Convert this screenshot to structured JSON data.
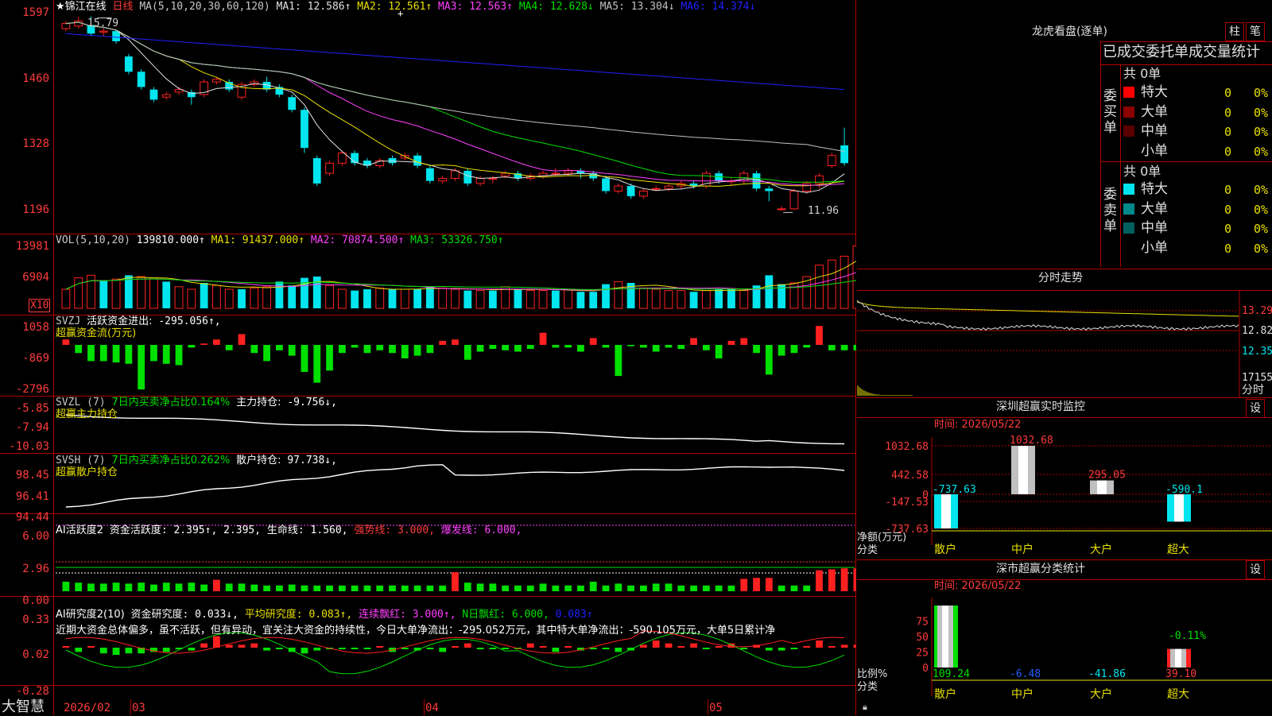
{
  "colors": {
    "up": "#ff2020",
    "down": "#00e5ee",
    "border": "#b00000",
    "ma1": "#e0e0e0",
    "ma2": "#e8e000",
    "ma3": "#ff40ff",
    "ma4": "#00e000",
    "ma5": "#c0c0c0",
    "ma6": "#2020ff"
  },
  "main_chart": {
    "stock_name": "★锦江在线",
    "period": "日线",
    "indicator": "MA(5,10,20,30,60,120)",
    "ma_items": [
      {
        "label": "MA1:",
        "value": "12.586↑"
      },
      {
        "label": "MA2:",
        "value": "12.561↑"
      },
      {
        "label": "MA3:",
        "value": "12.563↑"
      },
      {
        "label": "MA4:",
        "value": "12.628↓"
      },
      {
        "label": "MA5:",
        "value": "13.304↓"
      },
      {
        "label": "MA6:",
        "value": "14.374↓"
      }
    ],
    "y_ticks": [
      "1597",
      "1460",
      "1328",
      "1196"
    ],
    "high_label": "15.79",
    "low_label": "11.96",
    "price_range": [
      11.7,
      16.05
    ],
    "candles": [
      [
        15.55,
        15.65,
        15.5,
        15.7
      ],
      [
        15.6,
        15.7,
        15.55,
        15.78
      ],
      [
        15.62,
        15.45,
        15.4,
        15.79
      ],
      [
        15.48,
        15.5,
        15.4,
        15.56
      ],
      [
        15.5,
        15.3,
        15.25,
        15.52
      ],
      [
        15.0,
        14.7,
        14.65,
        15.05
      ],
      [
        14.7,
        14.4,
        14.35,
        14.75
      ],
      [
        14.35,
        14.15,
        14.1,
        14.4
      ],
      [
        14.2,
        14.25,
        14.15,
        14.3
      ],
      [
        14.3,
        14.35,
        14.25,
        14.4
      ],
      [
        14.3,
        14.2,
        14.05,
        14.35
      ],
      [
        14.25,
        14.5,
        14.2,
        14.55
      ],
      [
        14.5,
        14.55,
        14.45,
        14.6
      ],
      [
        14.5,
        14.35,
        14.3,
        14.55
      ],
      [
        14.2,
        14.45,
        14.15,
        14.5
      ],
      [
        14.45,
        14.5,
        14.4,
        14.55
      ],
      [
        14.5,
        14.35,
        14.3,
        14.6
      ],
      [
        14.4,
        14.25,
        14.2,
        14.45
      ],
      [
        14.2,
        13.95,
        13.9,
        14.25
      ],
      [
        13.95,
        13.2,
        13.1,
        14.0
      ],
      [
        13.0,
        12.5,
        12.45,
        13.05
      ],
      [
        12.7,
        12.9,
        12.65,
        12.95
      ],
      [
        12.9,
        13.1,
        12.85,
        13.15
      ],
      [
        13.1,
        12.9,
        12.85,
        13.15
      ],
      [
        12.95,
        12.85,
        12.8,
        13.0
      ],
      [
        12.85,
        12.95,
        12.8,
        13.0
      ],
      [
        13.0,
        12.9,
        12.85,
        13.05
      ],
      [
        13.0,
        13.05,
        12.95,
        13.1
      ],
      [
        13.05,
        12.85,
        12.8,
        13.1
      ],
      [
        12.8,
        12.55,
        12.5,
        12.85
      ],
      [
        12.55,
        12.6,
        12.5,
        12.65
      ],
      [
        12.6,
        12.75,
        12.55,
        12.8
      ],
      [
        12.75,
        12.5,
        12.45,
        12.8
      ],
      [
        12.5,
        12.6,
        12.45,
        12.65
      ],
      [
        12.6,
        12.6,
        12.5,
        12.65
      ],
      [
        12.65,
        12.7,
        12.6,
        12.75
      ],
      [
        12.7,
        12.6,
        12.55,
        12.75
      ],
      [
        12.6,
        12.65,
        12.55,
        12.7
      ],
      [
        12.65,
        12.7,
        12.6,
        12.75
      ],
      [
        12.7,
        12.7,
        12.65,
        12.8
      ],
      [
        12.7,
        12.75,
        12.65,
        12.8
      ],
      [
        12.75,
        12.7,
        12.6,
        12.8
      ],
      [
        12.7,
        12.6,
        12.55,
        12.75
      ],
      [
        12.6,
        12.35,
        12.3,
        12.65
      ],
      [
        12.35,
        12.45,
        12.3,
        12.5
      ],
      [
        12.45,
        12.25,
        12.2,
        12.5
      ],
      [
        12.25,
        12.35,
        12.2,
        12.4
      ],
      [
        12.4,
        12.4,
        12.35,
        12.45
      ],
      [
        12.4,
        12.45,
        12.35,
        12.5
      ],
      [
        12.45,
        12.5,
        12.4,
        12.55
      ],
      [
        12.5,
        12.45,
        12.4,
        12.55
      ],
      [
        12.45,
        12.7,
        12.4,
        12.75
      ],
      [
        12.7,
        12.55,
        12.5,
        12.75
      ],
      [
        12.55,
        12.55,
        12.45,
        12.6
      ],
      [
        12.55,
        12.7,
        12.5,
        12.75
      ],
      [
        12.7,
        12.4,
        12.35,
        12.75
      ],
      [
        12.4,
        12.35,
        12.15,
        12.45
      ],
      [
        12.0,
        12.0,
        11.96,
        12.05
      ],
      [
        12.0,
        12.35,
        11.98,
        12.4
      ],
      [
        12.35,
        12.5,
        12.3,
        12.55
      ],
      [
        12.5,
        12.65,
        12.4,
        12.7
      ],
      [
        12.85,
        13.05,
        12.8,
        13.1
      ],
      [
        13.25,
        12.9,
        12.85,
        13.6
      ]
    ]
  },
  "vol_panel": {
    "label": "VOL(5,10,20)",
    "value": "139810.000↑",
    "ma_items": [
      {
        "label": "MA1:",
        "value": "91437.000↑"
      },
      {
        "label": "MA2:",
        "value": "70874.500↑"
      },
      {
        "label": "MA3:",
        "value": "53326.750↑"
      }
    ],
    "y_ticks": [
      "13981",
      "6904"
    ],
    "unit_badge": "X10",
    "values": [
      30,
      48,
      52,
      44,
      46,
      52,
      50,
      48,
      42,
      34,
      30,
      40,
      36,
      30,
      30,
      32,
      34,
      42,
      36,
      48,
      50,
      36,
      30,
      28,
      30,
      32,
      30,
      30,
      30,
      34,
      32,
      30,
      28,
      28,
      28,
      34,
      30,
      28,
      28,
      28,
      30,
      26,
      26,
      38,
      42,
      40,
      32,
      30,
      28,
      28,
      26,
      28,
      30,
      30,
      28,
      36,
      52,
      38,
      40,
      50,
      68,
      76,
      82,
      98
    ],
    "ups": [
      1,
      1,
      1,
      0,
      1,
      0,
      1,
      1,
      0,
      1,
      1,
      0,
      1,
      1,
      0,
      1,
      1,
      0,
      0,
      0,
      0,
      1,
      1,
      0,
      0,
      1,
      0,
      1,
      0,
      0,
      1,
      1,
      0,
      1,
      0,
      1,
      0,
      1,
      1,
      0,
      1,
      0,
      0,
      0,
      1,
      0,
      1,
      1,
      1,
      1,
      0,
      1,
      0,
      0,
      1,
      0,
      0,
      0,
      1,
      1,
      1,
      1,
      1,
      1
    ]
  },
  "svzj_panel": {
    "label": "SVZJ",
    "desc": "活跃资金进出:",
    "value": "-295.056↑,",
    "subtitle": "超赢资金流(万元)",
    "y_ticks": [
      "1058",
      "-869",
      "-2796"
    ],
    "values": [
      40,
      -60,
      -120,
      -120,
      -130,
      -140,
      -330,
      -120,
      -140,
      -150,
      -20,
      10,
      40,
      -40,
      80,
      -60,
      -120,
      -40,
      -80,
      -200,
      -280,
      -190,
      -60,
      -20,
      -60,
      -40,
      -60,
      -100,
      -80,
      -60,
      30,
      40,
      -110,
      -50,
      -30,
      -40,
      -50,
      -30,
      90,
      -20,
      -20,
      -50,
      50,
      -20,
      -230,
      -10,
      -20,
      -50,
      -20,
      -30,
      50,
      -40,
      -100,
      30,
      50,
      -60,
      -220,
      -80,
      -60,
      -20,
      140,
      -40,
      -40,
      -40
    ]
  },
  "svzl_panel": {
    "label": "SVZL",
    "period": "(7)",
    "desc": "7日内买卖净占比0.164%",
    "value_label": "主力持仓:",
    "value": "-9.756↓,",
    "subtitle": "超赢主力持仓",
    "y_ticks": [
      "-5.85",
      "-7.94",
      "-10.03"
    ]
  },
  "svsh_panel": {
    "label": "SVSH",
    "period": "(7)",
    "desc": "7日内买卖净占比0.262%",
    "value_label": "散户持仓:",
    "value": "97.738↓,",
    "subtitle": "超赢散户持仓",
    "y_ticks": [
      "98.45",
      "96.41",
      "94.44"
    ]
  },
  "active_panel": {
    "label": "AI活跃度2",
    "items": [
      {
        "label": "资金活跃度:",
        "value": "2.395↑,",
        "color": "#ffffff"
      },
      {
        "label": "",
        "value": "2.395,",
        "color": "#ffffff"
      },
      {
        "label": "生命线:",
        "value": "1.560,",
        "color": "#ffffff"
      },
      {
        "label": "强势线:",
        "value": "3.000,",
        "color": "#ff3b3b"
      },
      {
        "label": "爆发线:",
        "value": "6.000,",
        "color": "#ff40ff"
      }
    ],
    "y_ticks": [
      "6.00",
      "2.96",
      "0.00"
    ],
    "values": [
      1.0,
      0.9,
      0.8,
      0.8,
      0.9,
      0.8,
      0.9,
      0.7,
      0.9,
      0.8,
      0.9,
      0.7,
      1.2,
      0.8,
      0.8,
      0.7,
      0.6,
      0.6,
      0.7,
      0.6,
      0.6,
      0.6,
      0.6,
      0.6,
      0.6,
      0.6,
      0.6,
      0.6,
      0.6,
      0.6,
      0.6,
      2.0,
      0.9,
      0.8,
      0.8,
      0.6,
      0.6,
      0.6,
      0.8,
      0.6,
      0.6,
      0.6,
      1.0,
      0.6,
      0.8,
      0.6,
      0.6,
      0.8,
      0.8,
      0.6,
      0.6,
      0.6,
      0.6,
      0.6,
      1.3,
      1.4,
      1.4,
      0.6,
      0.6,
      0.6,
      2.2,
      2.3,
      2.4,
      2.4
    ]
  },
  "research_panel": {
    "label": "AI研究度2(10)",
    "items": [
      {
        "label": "资金研究度:",
        "value": "0.033↓,",
        "color": "#ffffff"
      },
      {
        "label": "平均研究度:",
        "value": "0.083↑,",
        "color": "#e8e000"
      },
      {
        "label": "连续飘红:",
        "value": "3.000↑,",
        "color": "#ff40ff"
      },
      {
        "label": "N日飘红:",
        "value": "6.000,",
        "color": "#00e000"
      },
      {
        "label": "",
        "value": "0.083↑",
        "color": "#2020ff"
      }
    ],
    "commentary": "近期大资金总体偏多，虽不活跃，但有异动，宜关注大资金的持续性，今日大单净流出：-295.052万元，其中特大单净流出：-590.105万元，大单5日累计净",
    "y_ticks": [
      "0.33",
      "0.02",
      "-0.28"
    ],
    "values": [
      0.02,
      -0.06,
      0.02,
      -0.08,
      -0.1,
      -0.08,
      -0.08,
      -0.06,
      -0.06,
      -0.02,
      -0.04,
      0.06,
      0.16,
      0.04,
      0.04,
      0.06,
      -0.04,
      -0.02,
      -0.06,
      -0.08,
      -0.04,
      -0.02,
      -0.02,
      -0.02,
      -0.02,
      0.02,
      -0.06,
      -0.02,
      -0.04,
      -0.02,
      -0.06,
      0.02,
      0.06,
      -0.02,
      -0.02,
      -0.02,
      -0.02,
      0.06,
      0.02,
      -0.06,
      0.02,
      -0.04,
      -0.02,
      -0.02,
      -0.06,
      -0.04,
      0.04,
      0.1,
      0.06,
      0.02,
      0.06,
      -0.02,
      0.02,
      0.06,
      -0.02,
      0.04,
      -0.04,
      -0.04,
      -0.02,
      0.02,
      0.1,
      0.02,
      0.04,
      0.04
    ]
  },
  "bottom_bar": {
    "brand": "大智慧",
    "dates": [
      "2026/02",
      "03",
      "04",
      "05"
    ]
  },
  "dragon_tiger": {
    "title": "龙虎看盘(逐单)",
    "btn_column": "柱",
    "btn_pen": "笔",
    "header": "已成交委托单成交量统计",
    "buy_side": {
      "label": "委买单",
      "total": "共 0单",
      "rows": [
        {
          "name": "特大",
          "count": "0",
          "pct": "0%",
          "color": "#ff0000"
        },
        {
          "name": "大单",
          "count": "0",
          "pct": "0%",
          "color": "#8b0000"
        },
        {
          "name": "中单",
          "count": "0",
          "pct": "0%",
          "color": "#5a0000"
        },
        {
          "name": "小单",
          "count": "0",
          "pct": "0%",
          "color": ""
        }
      ]
    },
    "sell_side": {
      "label": "委卖单",
      "total": "共 0单",
      "rows": [
        {
          "name": "特大",
          "count": "0",
          "pct": "0%",
          "color": "#00e5ee"
        },
        {
          "name": "大单",
          "count": "0",
          "pct": "0%",
          "color": "#008b8b"
        },
        {
          "name": "中单",
          "count": "0",
          "pct": "0%",
          "color": "#006060"
        },
        {
          "name": "小单",
          "count": "0",
          "pct": "0%",
          "color": ""
        }
      ]
    }
  },
  "intraday": {
    "title": "分时走势",
    "y_ticks": [
      "13.29",
      "12.82",
      "12.35"
    ],
    "vol_tick": "17155",
    "corner_label": "分时"
  },
  "sz_monitor": {
    "title": "深圳超赢实时监控",
    "settings_btn": "设",
    "time": "时间: 2026/05/22",
    "y_ticks": [
      "1032.68",
      "442.58",
      "0",
      "-147.53",
      "-737.63"
    ],
    "axis_title": "净额(万元)",
    "axis_sub": "分类",
    "bars": [
      {
        "name": "散户",
        "value": -737.63,
        "label": "-737.63",
        "label_color": "#00e5ee"
      },
      {
        "name": "中户",
        "value": 1032.68,
        "label": "1032.68",
        "label_color": "#ff3b3b"
      },
      {
        "name": "大户",
        "value": 295.05,
        "label": "295.05",
        "label_color": "#ff3b3b"
      },
      {
        "name": "超大",
        "value": -590.1,
        "label": "-590.1",
        "label_color": "#00e5ee"
      }
    ]
  },
  "sz_classify": {
    "title": "深市超赢分类统计",
    "settings_btn": "设",
    "time": "时间: 2026/05/22",
    "y_ticks": [
      "75",
      "50",
      "25",
      "0"
    ],
    "axis_title": "比例%",
    "axis_sub": "分类",
    "inline_label": "-0.11%",
    "bars": [
      {
        "name": "散户",
        "value": 100,
        "label": "109.24",
        "label_color": "#00e000"
      },
      {
        "name": "中户",
        "value": 0,
        "label": "-6.48",
        "label_color": "#2060ff"
      },
      {
        "name": "大户",
        "value": 0,
        "label": "-41.86",
        "label_color": "#00e5ee"
      },
      {
        "name": "超大",
        "value": 30,
        "label": "39.10",
        "label_color": "#ff3b3b"
      }
    ]
  }
}
